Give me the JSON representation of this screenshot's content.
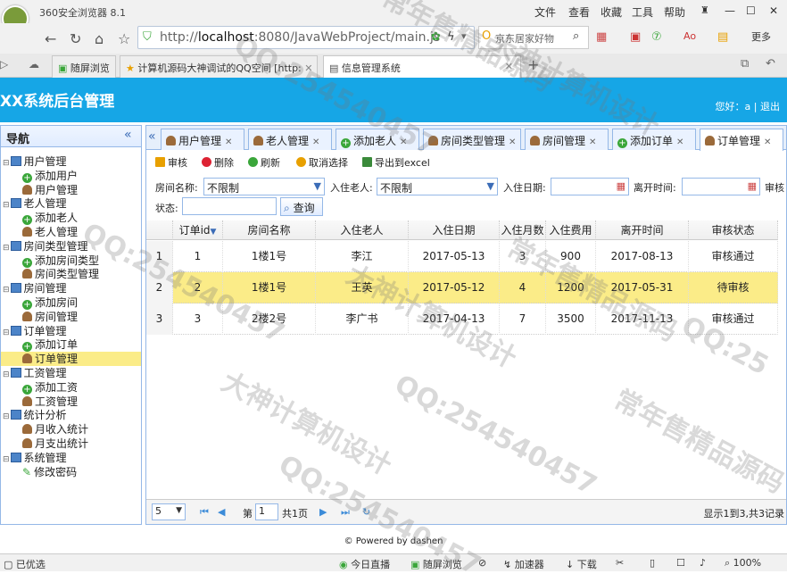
{
  "browser": {
    "title": "360安全浏览器 8.1",
    "menu": [
      "文件",
      "查看",
      "收藏",
      "工具",
      "帮助"
    ],
    "address_host": "localhost",
    "address_rest": ":8080/JavaWebProject/main.js",
    "address_scheme": "http://",
    "search_text": "京东居家好物",
    "extra": "更多",
    "tabs": [
      {
        "label": "随屏浏览",
        "active": false
      },
      {
        "label": "计算机源码大神调试的QQ空间 [http:",
        "active": false
      },
      {
        "label": "信息管理系统",
        "active": true
      }
    ]
  },
  "app": {
    "title": "XX系统后台管理",
    "greeting": "您好：a",
    "logout": "退出"
  },
  "sidebar": {
    "title": "导航",
    "items": [
      {
        "label": "用户管理",
        "type": "folder"
      },
      {
        "label": "添加用户",
        "type": "add"
      },
      {
        "label": "用户管理",
        "type": "leaf"
      },
      {
        "label": "老人管理",
        "type": "folder"
      },
      {
        "label": "添加老人",
        "type": "add"
      },
      {
        "label": "老人管理",
        "type": "leaf"
      },
      {
        "label": "房间类型管理",
        "type": "folder"
      },
      {
        "label": "添加房间类型",
        "type": "add"
      },
      {
        "label": "房间类型管理",
        "type": "leaf"
      },
      {
        "label": "房间管理",
        "type": "folder"
      },
      {
        "label": "添加房间",
        "type": "add"
      },
      {
        "label": "房间管理",
        "type": "leaf"
      },
      {
        "label": "订单管理",
        "type": "folder"
      },
      {
        "label": "添加订单",
        "type": "add"
      },
      {
        "label": "订单管理",
        "type": "leaf",
        "selected": true
      },
      {
        "label": "工资管理",
        "type": "folder"
      },
      {
        "label": "添加工资",
        "type": "add"
      },
      {
        "label": "工资管理",
        "type": "leaf"
      },
      {
        "label": "统计分析",
        "type": "folder"
      },
      {
        "label": "月收入统计",
        "type": "leaf"
      },
      {
        "label": "月支出统计",
        "type": "leaf"
      },
      {
        "label": "系统管理",
        "type": "folder"
      },
      {
        "label": "修改密码",
        "type": "edit"
      }
    ]
  },
  "tabs": [
    {
      "label": "用户管理",
      "icon": "user"
    },
    {
      "label": "老人管理",
      "icon": "user"
    },
    {
      "label": "添加老人",
      "icon": "add"
    },
    {
      "label": "房间类型管理",
      "icon": "user"
    },
    {
      "label": "房间管理",
      "icon": "user"
    },
    {
      "label": "添加订单",
      "icon": "add"
    },
    {
      "label": "订单管理",
      "icon": "user",
      "active": true
    }
  ],
  "toolbar": {
    "audit": "审核",
    "delete": "删除",
    "refresh": "刷新",
    "unselect": "取消选择",
    "export": "导出到excel"
  },
  "filters": {
    "room_label": "房间名称:",
    "room_value": "不限制",
    "elder_label": "入住老人:",
    "elder_value": "不限制",
    "checkin_label": "入住日期:",
    "checkout_label": "离开时间:",
    "audit_label": "审核",
    "status_label": "状态:",
    "query": "查询"
  },
  "table": {
    "columns": [
      "订单id",
      "房间名称",
      "入住老人",
      "入住日期",
      "入住月数",
      "入住费用",
      "离开时间",
      "审核状态"
    ],
    "rows": [
      {
        "rn": "1",
        "id": "1",
        "room": "1楼1号",
        "elder": "李江",
        "date": "2017-05-13",
        "months": "3",
        "fee": "900",
        "leave": "2017-08-13",
        "status": "审核通过"
      },
      {
        "rn": "2",
        "id": "2",
        "room": "1楼1号",
        "elder": "王英",
        "date": "2017-05-12",
        "months": "4",
        "fee": "1200",
        "leave": "2017-05-31",
        "status": "待审核",
        "selected": true
      },
      {
        "rn": "3",
        "id": "3",
        "room": "2楼2号",
        "elder": "李广书",
        "date": "2017-04-13",
        "months": "7",
        "fee": "3500",
        "leave": "2017-11-13",
        "status": "审核通过"
      }
    ]
  },
  "pager": {
    "page_size": "5",
    "page_prefix": "第",
    "page_num": "1",
    "page_suffix": "共1页",
    "summary": "显示1到3,共3记录"
  },
  "footer": "© Powered by dashen",
  "statusbar": [
    "已优选",
    "今日直播",
    "随屏浏览",
    "加速器",
    "下载",
    "100%"
  ],
  "watermarks": [
    "QQ:254540457",
    "大神计算机设计",
    "常年售精品源码",
    "QQ:254540457",
    "大神计算机设计",
    "常年售精品源码",
    "QQ:254540457",
    "大神计算机设计",
    "QQ:254540457",
    "常年售精品源码",
    "QQ:25"
  ]
}
